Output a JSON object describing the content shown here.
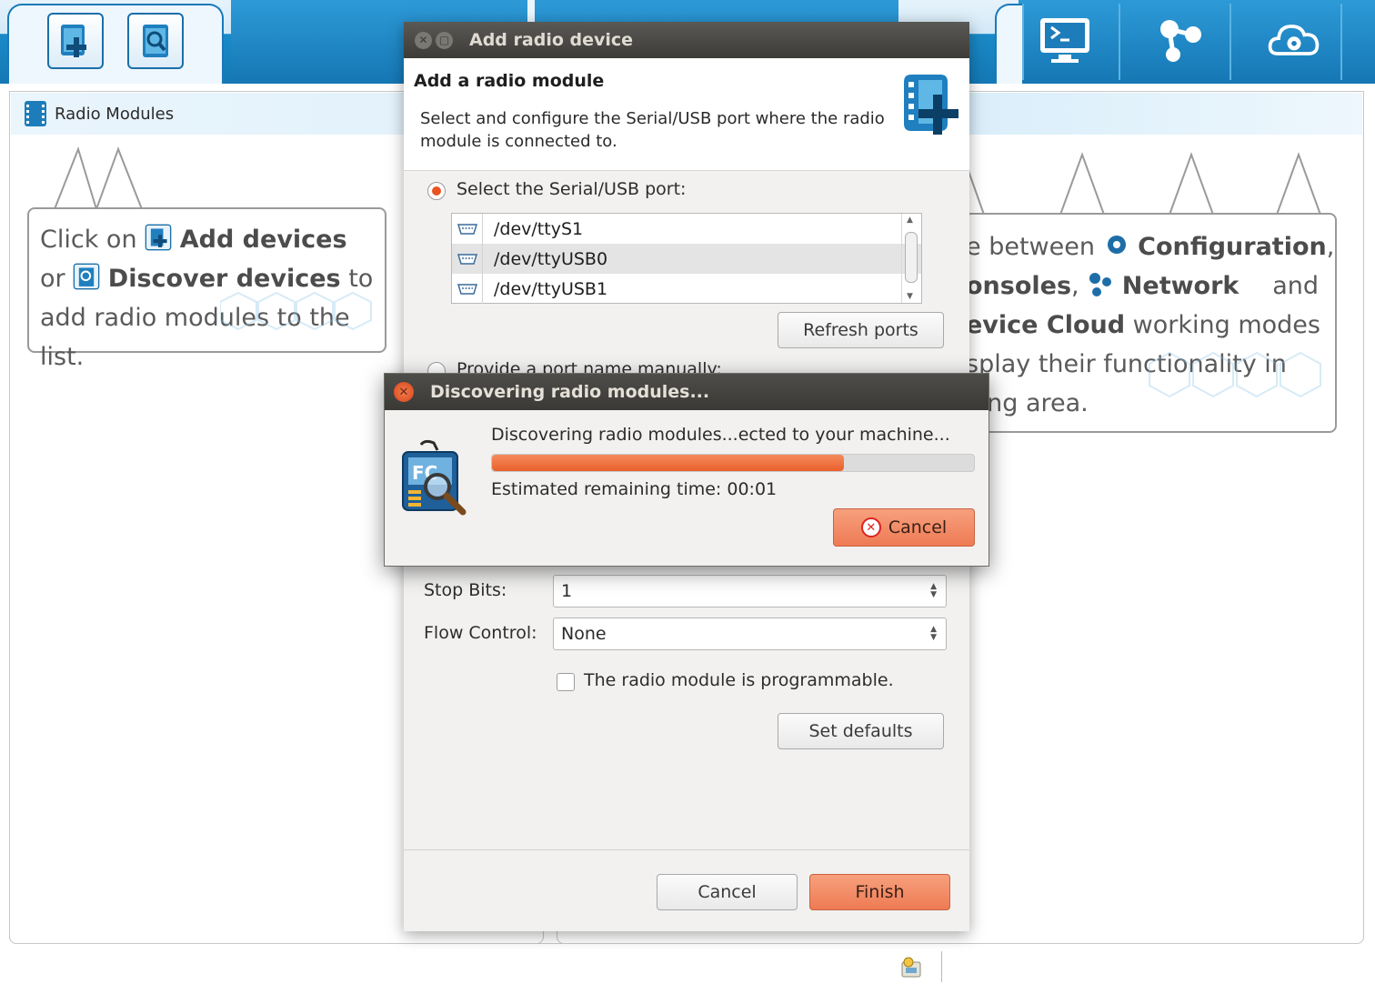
{
  "toolbar": {
    "left_buttons": [
      {
        "name": "add-devices",
        "icon": "add-device-icon"
      },
      {
        "name": "discover-devices",
        "icon": "discover-device-icon"
      }
    ],
    "right_buttons": [
      {
        "name": "configuration-mode",
        "icon": "gear-icon"
      },
      {
        "name": "consoles-mode",
        "icon": "console-icon"
      },
      {
        "name": "network-mode",
        "icon": "network-icon"
      },
      {
        "name": "cloud-mode",
        "icon": "cloud-gear-icon"
      }
    ]
  },
  "radio_modules": {
    "header": "Radio Modules"
  },
  "left_callout": {
    "p1": "Click on ",
    "b1": "Add devices",
    "p2": " or ",
    "b2": "Discover devices",
    "p3": " to add radio modules to the list."
  },
  "right_callout": {
    "p1": "e between ",
    "b1": "Configuration",
    "p2": ",",
    "b2": "onsoles",
    "p3": ", ",
    "b3": "Network",
    "p4": " and",
    "b4": "evice Cloud",
    "p5": " working modes",
    "p6": "splay their functionality in",
    "p7": "king area."
  },
  "add_dialog": {
    "title": "Add radio device",
    "heading": "Add a radio module",
    "description": "Select and configure the Serial/USB port where the radio module is connected to.",
    "select_port_label": "Select the Serial/USB port:",
    "ports": [
      "/dev/ttyS1",
      "/dev/ttyUSB0",
      "/dev/ttyUSB1"
    ],
    "selected_port_index": 1,
    "refresh_label": "Refresh ports",
    "manual_label": "Provide a port name manually:",
    "stop_bits_label": "Stop Bits:",
    "stop_bits_value": "1",
    "flow_control_label": "Flow Control:",
    "flow_control_value": "None",
    "programmable_label": "The radio module is programmable.",
    "programmable_checked": false,
    "set_defaults_label": "Set defaults",
    "cancel_label": "Cancel",
    "finish_label": "Finish"
  },
  "discover_dialog": {
    "title": "Discovering radio modules...",
    "message": "Discovering radio modules...ected to your machine...",
    "progress_percent": 73,
    "eta": "Estimated remaining time: 00:01",
    "cancel_label": "Cancel"
  },
  "colors": {
    "accent": "#e95420",
    "toolbar_blue": "#1a84c3",
    "progress": "#ee6d3b"
  }
}
